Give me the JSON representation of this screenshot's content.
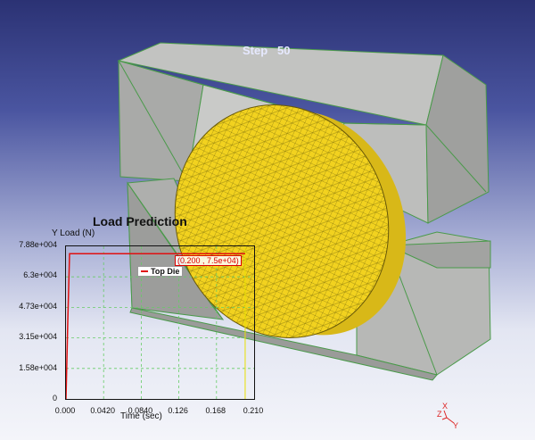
{
  "viewport": {
    "step_label": "Step   50"
  },
  "axis_triad": {
    "x": "X",
    "z": "Z",
    "y": "Y",
    "color": "#dd2222"
  },
  "colors": {
    "die": "#b5b6b4",
    "edge": "#4a9a4a",
    "workpiece": "#f2d21f",
    "mesh": "#8a7a10",
    "series": "#e01010",
    "grid": "#66cc66"
  },
  "chart": {
    "title": "Load Prediction",
    "ylabel": "Y Load (N)",
    "xlabel": "Time (sec)",
    "legend": "Top Die",
    "annotation": "(0.200 , 7.5e+04)",
    "yticks": [
      "7.88e+004",
      "6.3e+004",
      "4.73e+004",
      "3.15e+004",
      "1.58e+004",
      "0"
    ],
    "xticks": [
      "0.000",
      "0.0420",
      "0.0840",
      "0.126",
      "0.168",
      "0.210"
    ]
  },
  "chart_data": {
    "type": "line",
    "title": "Load Prediction",
    "xlabel": "Time (sec)",
    "ylabel": "Y Load (N)",
    "xlim": [
      0,
      0.21
    ],
    "ylim": [
      0,
      78800
    ],
    "grid": true,
    "legend_position": "top-center",
    "series": [
      {
        "name": "Top Die",
        "x": [
          0.0,
          0.002,
          0.004,
          0.2
        ],
        "y": [
          0,
          40000,
          75000,
          75000
        ]
      }
    ],
    "annotations": [
      {
        "x": 0.2,
        "y": 75000,
        "text": "(0.200 , 7.5e+04)"
      }
    ]
  }
}
